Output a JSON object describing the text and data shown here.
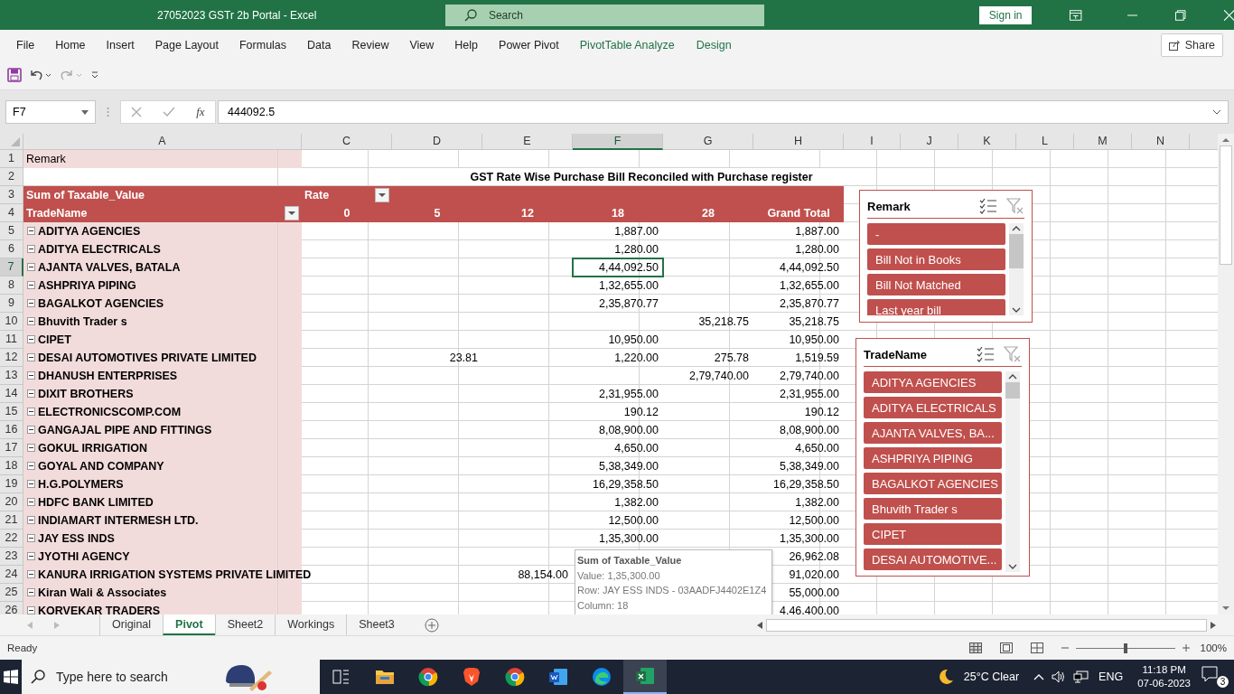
{
  "window": {
    "title": "27052023 GSTr 2b Portal  -  Excel",
    "search_placeholder": "Search",
    "sign_in": "Sign in"
  },
  "ribbon_tabs": [
    {
      "label": "File",
      "kind": "normal"
    },
    {
      "label": "Home",
      "kind": "normal"
    },
    {
      "label": "Insert",
      "kind": "normal"
    },
    {
      "label": "Page Layout",
      "kind": "normal"
    },
    {
      "label": "Formulas",
      "kind": "normal"
    },
    {
      "label": "Data",
      "kind": "normal"
    },
    {
      "label": "Review",
      "kind": "normal"
    },
    {
      "label": "View",
      "kind": "normal"
    },
    {
      "label": "Help",
      "kind": "normal"
    },
    {
      "label": "Power Pivot",
      "kind": "normal"
    },
    {
      "label": "PivotTable Analyze",
      "kind": "contextual"
    },
    {
      "label": "Design",
      "kind": "contextual"
    }
  ],
  "share": "Share",
  "formula_bar": {
    "name_box": "F7",
    "function_label": "fx",
    "value": "444092.5"
  },
  "columns": [
    {
      "label": "A",
      "selected": false
    },
    {
      "label": "C",
      "selected": false
    },
    {
      "label": "D",
      "selected": false
    },
    {
      "label": "E",
      "selected": false
    },
    {
      "label": "F",
      "selected": true
    },
    {
      "label": "G",
      "selected": false
    },
    {
      "label": "H",
      "selected": false
    },
    {
      "label": "I",
      "selected": false
    },
    {
      "label": "J",
      "selected": false
    },
    {
      "label": "K",
      "selected": false
    },
    {
      "label": "L",
      "selected": false
    },
    {
      "label": "M",
      "selected": false
    },
    {
      "label": "N",
      "selected": false
    }
  ],
  "pivot": {
    "header_row_numbers": [
      "1",
      "2",
      "3",
      "4"
    ],
    "filter_label": "Remark",
    "title": "GST Rate Wise Purchase Bill Reconciled with Purchase register",
    "values_label": "Sum of Taxable_Value",
    "column_label": "Rate",
    "row_label": "TradeName",
    "rate_headers": [
      "0",
      "5",
      "12",
      "18",
      "28",
      "Grand Total"
    ],
    "rows": [
      {
        "number": "5",
        "trade_name": "ADITYA AGENCIES",
        "rate_18": "1,887.00",
        "grand_total": "1,887.00",
        "selected": false
      },
      {
        "number": "6",
        "trade_name": "ADITYA ELECTRICALS",
        "rate_18": "1,280.00",
        "grand_total": "1,280.00",
        "selected": false
      },
      {
        "number": "7",
        "trade_name": "AJANTA VALVES, BATALA",
        "rate_18": "4,44,092.50",
        "grand_total": "4,44,092.50",
        "selected": true
      },
      {
        "number": "8",
        "trade_name": "ASHPRIYA PIPING",
        "rate_18": "1,32,655.00",
        "grand_total": "1,32,655.00",
        "selected": false
      },
      {
        "number": "9",
        "trade_name": "BAGALKOT AGENCIES",
        "rate_18": "2,35,870.77",
        "grand_total": "2,35,870.77",
        "selected": false
      },
      {
        "number": "10",
        "trade_name": "Bhuvith Trader s",
        "rate_28": "35,218.75",
        "grand_total": "35,218.75",
        "selected": false
      },
      {
        "number": "11",
        "trade_name": "CIPET",
        "rate_18": "10,950.00",
        "grand_total": "10,950.00",
        "selected": false
      },
      {
        "number": "12",
        "trade_name": "DESAI AUTOMOTIVES PRIVATE LIMITED",
        "rate_5": "23.81",
        "rate_18": "1,220.00",
        "rate_28": "275.78",
        "grand_total": "1,519.59",
        "selected": false
      },
      {
        "number": "13",
        "trade_name": "DHANUSH ENTERPRISES",
        "rate_28": "2,79,740.00",
        "grand_total": "2,79,740.00",
        "selected": false
      },
      {
        "number": "14",
        "trade_name": "DIXIT BROTHERS",
        "rate_18": "2,31,955.00",
        "grand_total": "2,31,955.00",
        "selected": false
      },
      {
        "number": "15",
        "trade_name": "ELECTRONICSCOMP.COM",
        "rate_18": "190.12",
        "grand_total": "190.12",
        "selected": false
      },
      {
        "number": "16",
        "trade_name": "GANGAJAL PIPE AND FITTINGS",
        "rate_18": "8,08,900.00",
        "grand_total": "8,08,900.00",
        "selected": false
      },
      {
        "number": "17",
        "trade_name": "GOKUL IRRIGATION",
        "rate_18": "4,650.00",
        "grand_total": "4,650.00",
        "selected": false
      },
      {
        "number": "18",
        "trade_name": "GOYAL AND COMPANY",
        "rate_18": "5,38,349.00",
        "grand_total": "5,38,349.00",
        "selected": false
      },
      {
        "number": "19",
        "trade_name": "H.G.POLYMERS",
        "rate_18": "16,29,358.50",
        "grand_total": "16,29,358.50",
        "selected": false
      },
      {
        "number": "20",
        "trade_name": "HDFC BANK LIMITED",
        "rate_18": "1,382.00",
        "grand_total": "1,382.00",
        "selected": false
      },
      {
        "number": "21",
        "trade_name": "INDIAMART INTERMESH LTD.",
        "rate_18": "12,500.00",
        "grand_total": "12,500.00",
        "selected": false
      },
      {
        "number": "22",
        "trade_name": "JAY ESS INDS",
        "rate_18": "1,35,300.00",
        "grand_total": "1,35,300.00",
        "selected": false
      },
      {
        "number": "23",
        "trade_name": "JYOTHI AGENCY",
        "grand_total": "26,962.08",
        "selected": false
      },
      {
        "number": "24",
        "trade_name": "KANURA IRRIGATION SYSTEMS PRIVATE LIMITED",
        "rate_12": "88,154.00",
        "grand_total": "91,020.00",
        "selected": false
      },
      {
        "number": "25",
        "trade_name": "Kiran Wali & Associates",
        "grand_total": "55,000.00",
        "selected": false
      },
      {
        "number": "26",
        "trade_name": "KORVEKAR TRADERS",
        "grand_total": "4,46,400.00",
        "selected": false
      }
    ]
  },
  "tooltip": {
    "title": "Sum of Taxable_Value",
    "lines": [
      "Value:  1,35,300.00",
      "Row: JAY ESS INDS - 03AADFJ4402E1Z4",
      "Column: 18"
    ]
  },
  "slicers": [
    {
      "title": "Remark",
      "items": [
        {
          "label": "-",
          "selected": true
        },
        {
          "label": "Bill Not in Books",
          "selected": true
        },
        {
          "label": "Bill Not Matched",
          "selected": true
        },
        {
          "label": "Last year bill",
          "selected": true
        }
      ]
    },
    {
      "title": "TradeName",
      "items": [
        {
          "label": "ADITYA AGENCIES",
          "selected": true
        },
        {
          "label": "ADITYA ELECTRICALS",
          "selected": true
        },
        {
          "label": "AJANTA VALVES, BA...",
          "selected": true
        },
        {
          "label": "ASHPRIYA PIPING",
          "selected": true
        },
        {
          "label": "BAGALKOT AGENCIES",
          "selected": true
        },
        {
          "label": "Bhuvith Trader s",
          "selected": true
        },
        {
          "label": "CIPET",
          "selected": true
        },
        {
          "label": "DESAI AUTOMOTIVE...",
          "selected": true
        }
      ]
    }
  ],
  "sheet_tabs": [
    {
      "label": "Original",
      "selected": false
    },
    {
      "label": "Pivot",
      "selected": true
    },
    {
      "label": "Sheet2",
      "selected": false
    },
    {
      "label": "Workings",
      "selected": false
    },
    {
      "label": "Sheet3",
      "selected": false
    }
  ],
  "status_bar": {
    "status": "Ready",
    "zoom": "100%",
    "zoom_slider": {
      "level": 0.5
    }
  },
  "taskbar": {
    "search_placeholder": "Type here to search",
    "apps": [
      {
        "kind": "taskview",
        "active": false
      },
      {
        "kind": "explorer",
        "active": false
      },
      {
        "kind": "chrome",
        "active": false
      },
      {
        "kind": "brave",
        "active": false
      },
      {
        "kind": "chrome",
        "active": false
      },
      {
        "kind": "word",
        "active": false
      },
      {
        "kind": "edge",
        "active": false
      },
      {
        "kind": "excel",
        "active": true
      }
    ],
    "weather": "25°C Clear",
    "language": "ENG",
    "time": "11:18 PM",
    "date": "07-06-2023",
    "notifications": "3"
  }
}
